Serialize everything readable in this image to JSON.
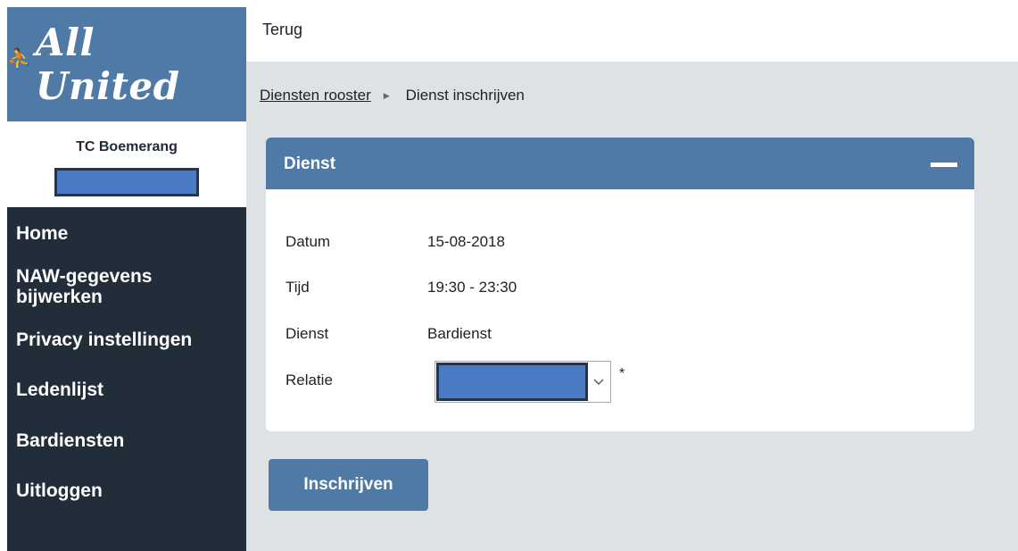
{
  "sidebar": {
    "logo_mark": "𝕀",
    "logo_text": "All United",
    "club_name": "TC Boemerang",
    "nav": [
      {
        "label": "Home"
      },
      {
        "label": "NAW-gegevens bijwerken"
      },
      {
        "label": "Privacy instellingen"
      },
      {
        "label": "Ledenlijst"
      },
      {
        "label": "Bardiensten"
      },
      {
        "label": "Uitloggen"
      }
    ]
  },
  "topbar": {
    "back_label": "Terug"
  },
  "breadcrumb": {
    "parent": "Diensten rooster",
    "separator": "▶",
    "current": "Dienst inschrijven"
  },
  "panel": {
    "title": "Dienst",
    "rows": [
      {
        "label": "Datum",
        "value": "15-08-2018"
      },
      {
        "label": "Tijd",
        "value": "19:30 - 23:30"
      },
      {
        "label": "Dienst",
        "value": "Bardienst"
      }
    ],
    "relation": {
      "label": "Relatie",
      "required_mark": "*",
      "arrow_icon": "chevron-down-icon"
    }
  },
  "actions": {
    "submit_label": "Inschrijven"
  },
  "colors": {
    "brand_blue": "#4f7aa6",
    "sidebar_dark": "#222d3a",
    "content_bg": "#dfe2e5",
    "redaction_blue": "#4b7bc4"
  }
}
